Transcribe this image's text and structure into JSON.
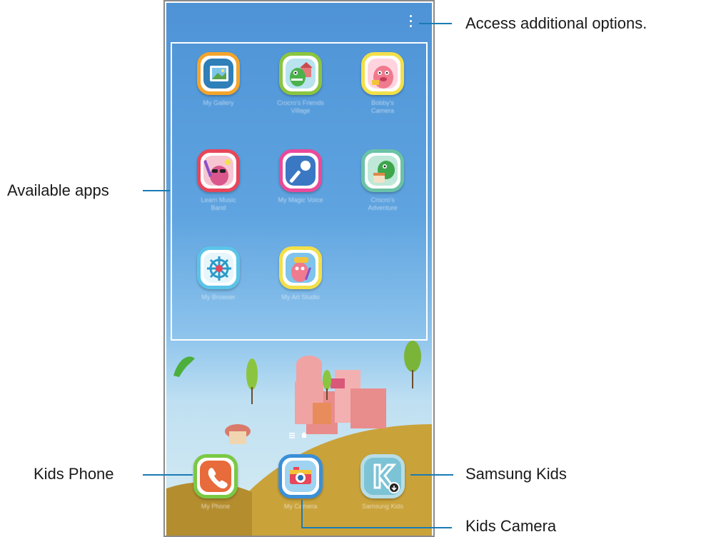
{
  "callouts": {
    "options": "Access additional options.",
    "available_apps": "Available apps",
    "kids_phone": "Kids Phone",
    "samsung_kids": "Samsung Kids",
    "kids_camera": "Kids Camera"
  },
  "apps": [
    {
      "icon": "gallery-icon",
      "label": "My Gallery"
    },
    {
      "icon": "crocro-village-icon",
      "label": "Crocro's Friends Village"
    },
    {
      "icon": "bobby-camera-icon",
      "label": "Bobby's Camera"
    },
    {
      "icon": "music-band-icon",
      "label": "Learn Music Band"
    },
    {
      "icon": "microphone-icon",
      "label": "My Magic Voice"
    },
    {
      "icon": "crocro-adventure-icon",
      "label": "Crocro's Adventure"
    },
    {
      "icon": "browser-helm-icon",
      "label": "My Browser"
    },
    {
      "icon": "art-studio-icon",
      "label": "My Art Studio"
    }
  ],
  "dock": [
    {
      "icon": "phone-icon",
      "label": "My Phone"
    },
    {
      "icon": "camera-icon",
      "label": "My Camera"
    },
    {
      "icon": "samsung-kids-icon",
      "label": "Samsung Kids"
    }
  ],
  "colors": {
    "callout_line": "#1a7bb5",
    "sky_top": "#4e93d6",
    "hill": "#c9a23a"
  }
}
